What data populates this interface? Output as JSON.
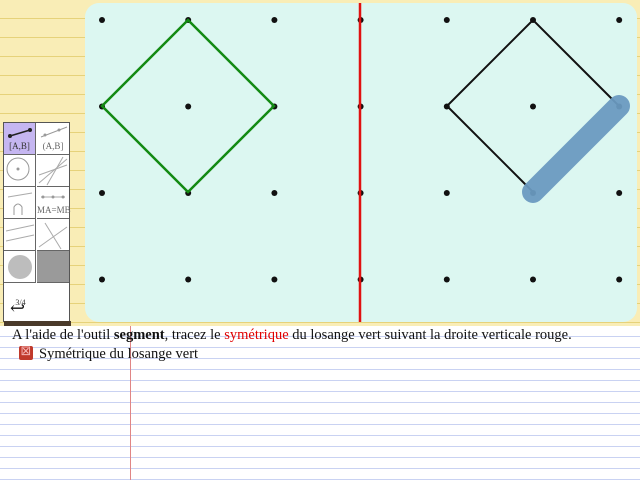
{
  "palette": {
    "tools": [
      {
        "name": "segment",
        "label": "[A,B]",
        "active": true
      },
      {
        "name": "ray",
        "label": "(A,B]",
        "active": false
      },
      {
        "name": "circle",
        "label": "",
        "active": false
      },
      {
        "name": "lines",
        "label": "",
        "active": false
      },
      {
        "name": "angle",
        "label": "",
        "active": false
      },
      {
        "name": "midpoint",
        "label": "MA=MB",
        "active": false
      },
      {
        "name": "parallel",
        "label": "",
        "active": false
      },
      {
        "name": "perpendicular",
        "label": "",
        "active": false
      },
      {
        "name": "fill",
        "label": "",
        "active": false
      },
      {
        "name": "gray",
        "label": "",
        "active": false
      }
    ],
    "page": "3/4",
    "undo_glyph": "↩"
  },
  "instruction": {
    "part1": "A l'aide de l'outil ",
    "bold": "segment",
    "part2": ", tracez le ",
    "red": "symétrique",
    "part3": " du losange vert suivant la droite verticale rouge."
  },
  "task": {
    "icon": "close-icon",
    "label": "Symétrique du losange vert"
  },
  "colors": {
    "green": "#138a13",
    "red": "#e01010",
    "highlight": "#6a9ac0"
  }
}
